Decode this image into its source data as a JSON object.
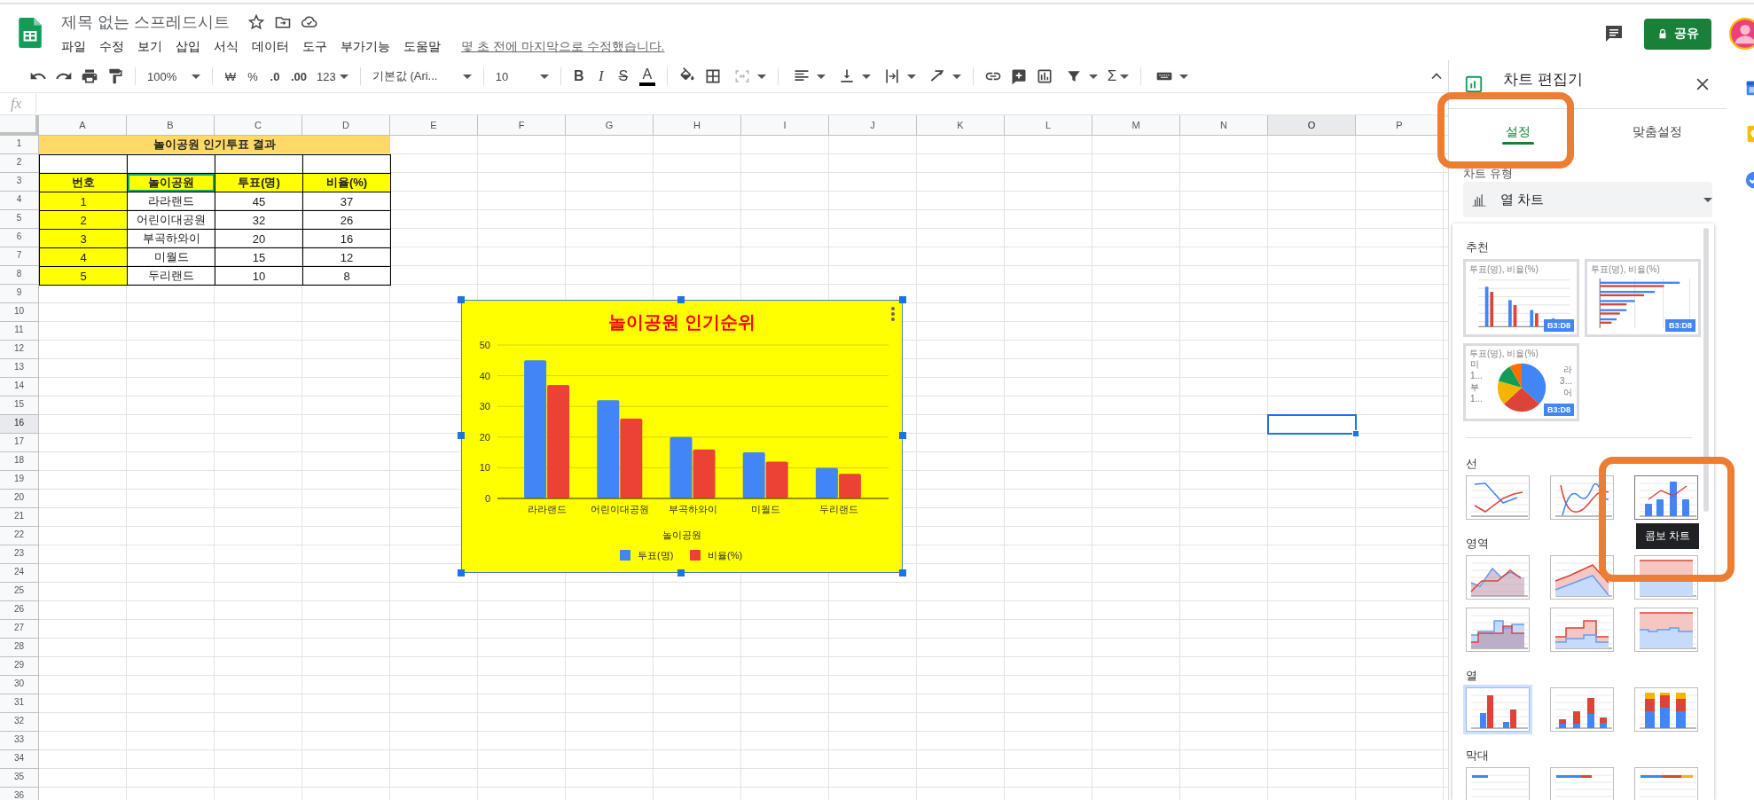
{
  "app": {
    "title": "제목 없는 스프레드시트",
    "menus": [
      "파일",
      "수정",
      "보기",
      "삽입",
      "서식",
      "데이터",
      "도구",
      "부가기능",
      "도움말"
    ],
    "last_edit": "몇 초 전에 마지막으로 수정했습니다.",
    "share": "공유"
  },
  "toolbar": {
    "zoom": "100%",
    "currency": "₩",
    "percent": "%",
    "decrease_decimal": ".0",
    "increase_decimal": ".00",
    "number_format": "123",
    "font": "기본값 (Ari...",
    "font_size": "10",
    "bold": "B",
    "italic": "I",
    "strikethrough": "S",
    "text_color": "A",
    "functions": "Σ"
  },
  "formula_bar": {
    "label": "fx"
  },
  "sheet": {
    "columns": [
      {
        "label": "A",
        "selected": false
      },
      {
        "label": "B",
        "selected": false
      },
      {
        "label": "C",
        "selected": false
      },
      {
        "label": "D",
        "selected": false
      },
      {
        "label": "E",
        "selected": false
      },
      {
        "label": "F",
        "selected": false
      },
      {
        "label": "G",
        "selected": false
      },
      {
        "label": "H",
        "selected": false
      },
      {
        "label": "I",
        "selected": false
      },
      {
        "label": "J",
        "selected": false
      },
      {
        "label": "K",
        "selected": false
      },
      {
        "label": "L",
        "selected": false
      },
      {
        "label": "M",
        "selected": false
      },
      {
        "label": "N",
        "selected": false
      },
      {
        "label": "O",
        "selected": true
      },
      {
        "label": "P",
        "selected": false
      }
    ],
    "rows": [
      {
        "label": "1",
        "selected": false
      },
      {
        "label": "2",
        "selected": false
      },
      {
        "label": "3",
        "selected": false
      },
      {
        "label": "4",
        "selected": false
      },
      {
        "label": "5",
        "selected": false
      },
      {
        "label": "6",
        "selected": false
      },
      {
        "label": "7",
        "selected": false
      },
      {
        "label": "8",
        "selected": false
      },
      {
        "label": "9",
        "selected": false
      },
      {
        "label": "10",
        "selected": false
      },
      {
        "label": "11",
        "selected": false
      },
      {
        "label": "12",
        "selected": false
      },
      {
        "label": "13",
        "selected": false
      },
      {
        "label": "14",
        "selected": false
      },
      {
        "label": "15",
        "selected": false
      },
      {
        "label": "16",
        "selected": true
      },
      {
        "label": "17",
        "selected": false
      },
      {
        "label": "18",
        "selected": false
      },
      {
        "label": "19",
        "selected": false
      },
      {
        "label": "20",
        "selected": false
      },
      {
        "label": "21",
        "selected": false
      },
      {
        "label": "22",
        "selected": false
      },
      {
        "label": "23",
        "selected": false
      },
      {
        "label": "24",
        "selected": false
      },
      {
        "label": "25",
        "selected": false
      },
      {
        "label": "26",
        "selected": false
      },
      {
        "label": "27",
        "selected": false
      },
      {
        "label": "28",
        "selected": false
      },
      {
        "label": "29",
        "selected": false
      },
      {
        "label": "30",
        "selected": false
      },
      {
        "label": "31",
        "selected": false
      },
      {
        "label": "32",
        "selected": false
      },
      {
        "label": "33",
        "selected": false
      },
      {
        "label": "34",
        "selected": false
      },
      {
        "label": "35",
        "selected": false
      },
      {
        "label": "36",
        "selected": false
      }
    ],
    "table": {
      "title": "놀이공원 인기투표 결과",
      "header": [
        {
          "text": "번호",
          "outlined": false
        },
        {
          "text": "놀이공원",
          "outlined": true
        },
        {
          "text": "투표(명)",
          "outlined": false
        },
        {
          "text": "비율(%)",
          "outlined": false
        }
      ],
      "rows": [
        [
          "1",
          "라라랜드",
          "45",
          "37"
        ],
        [
          "2",
          "어린이대공원",
          "32",
          "26"
        ],
        [
          "3",
          "부곡하와이",
          "20",
          "16"
        ],
        [
          "4",
          "미월드",
          "15",
          "12"
        ],
        [
          "5",
          "두리랜드",
          "10",
          "8"
        ]
      ]
    },
    "chart": {
      "chart_data": {
        "type": "bar",
        "title": "놀이공원 인기순위",
        "xlabel": "놀이공원",
        "categories": [
          "라라랜드",
          "어린이대공원",
          "부곡하와이",
          "미월드",
          "두리랜드"
        ],
        "series": [
          {
            "name": "투표(명)",
            "color": "#4285f4",
            "values": [
              45,
              32,
              20,
              15,
              10
            ]
          },
          {
            "name": "비율(%)",
            "color": "#ea4335",
            "values": [
              37,
              26,
              16,
              12,
              8
            ]
          }
        ],
        "ylim": [
          0,
          50
        ],
        "yticks": [
          {
            "value": 0,
            "label": "0"
          },
          {
            "value": 10,
            "label": "10"
          },
          {
            "value": 20,
            "label": "20"
          },
          {
            "value": 30,
            "label": "30"
          },
          {
            "value": 40,
            "label": "40"
          },
          {
            "value": 50,
            "label": "50"
          }
        ],
        "grid": true,
        "legend": "bottom"
      }
    }
  },
  "chart_editor": {
    "title": "차트 편집기",
    "tabs": [
      {
        "label": "설정",
        "selected": true,
        "highlighted": true
      },
      {
        "label": "맞춤설정",
        "selected": false,
        "highlighted": false
      }
    ],
    "type_label": "차트 유형",
    "type_value": "열 차트",
    "sections": [
      {
        "label": "추천",
        "items": [
          {
            "kind": "rec_column",
            "caption": "투표(명), 비율(%)",
            "badge": "B3:D8",
            "selected": false,
            "highlighted": false
          },
          {
            "kind": "rec_bar",
            "caption": "투표(명), 비율(%)",
            "badge": "B3:D8",
            "selected": false,
            "highlighted": false
          },
          {
            "kind": "rec_pie",
            "caption": "투표(명), 비율(%)",
            "badge": "B3:D8",
            "left_labels": [
              "미",
              "1...",
              "부",
              "1..."
            ],
            "right_labels": [
              "라",
              "3...",
              "어"
            ],
            "selected": false,
            "highlighted": false
          }
        ]
      },
      {
        "label": "선",
        "items": [
          {
            "kind": "line",
            "selected": false,
            "highlighted": false
          },
          {
            "kind": "smooth_line",
            "selected": false,
            "highlighted": false
          },
          {
            "kind": "combo",
            "selected": false,
            "highlighted": true,
            "tooltip": "콤보 차트"
          }
        ]
      },
      {
        "label": "영역",
        "items": [
          {
            "kind": "area",
            "selected": false,
            "highlighted": false
          },
          {
            "kind": "stacked_area",
            "selected": false,
            "highlighted": false
          },
          {
            "kind": "full_area",
            "selected": false,
            "highlighted": false
          },
          {
            "kind": "stepped_area",
            "selected": false,
            "highlighted": false
          },
          {
            "kind": "stacked_stepped_area",
            "selected": false,
            "highlighted": false
          },
          {
            "kind": "full_stepped_area",
            "selected": false,
            "highlighted": false
          }
        ]
      },
      {
        "label": "열",
        "items": [
          {
            "kind": "column",
            "selected": true,
            "highlighted": false
          },
          {
            "kind": "stacked_column",
            "selected": false,
            "highlighted": false
          },
          {
            "kind": "full_column",
            "selected": false,
            "highlighted": false
          }
        ]
      },
      {
        "label": "막대",
        "items": [
          {
            "kind": "bar",
            "selected": false,
            "highlighted": false
          },
          {
            "kind": "stacked_bar",
            "selected": false,
            "highlighted": false
          },
          {
            "kind": "full_bar",
            "selected": false,
            "highlighted": false
          }
        ]
      }
    ]
  }
}
